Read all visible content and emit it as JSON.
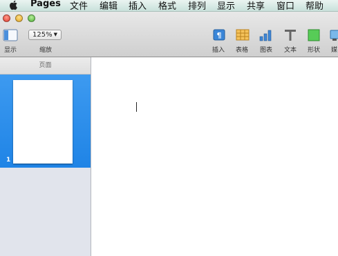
{
  "menubar": {
    "app_name": "Pages",
    "items": [
      "文件",
      "编辑",
      "插入",
      "格式",
      "排列",
      "显示",
      "共享",
      "窗口",
      "帮助"
    ]
  },
  "toolbar": {
    "view_label": "显示",
    "zoom_value": "125%",
    "zoom_label": "缩放",
    "tools": [
      {
        "label": "插入",
        "icon": "paragraph-insert-icon"
      },
      {
        "label": "表格",
        "icon": "table-icon"
      },
      {
        "label": "图表",
        "icon": "bar-chart-icon"
      },
      {
        "label": "文本",
        "icon": "text-T-icon"
      },
      {
        "label": "形状",
        "icon": "shape-square-icon"
      },
      {
        "label": "媒",
        "icon": "media-icon"
      }
    ]
  },
  "sidebar": {
    "header": "页面",
    "pages": [
      {
        "number": "1"
      }
    ]
  },
  "colors": {
    "selection_blue": "#2a8cec",
    "shape_green": "#4fc84f",
    "table_orange": "#f0b43c",
    "chart_blue": "#3f87d6"
  }
}
